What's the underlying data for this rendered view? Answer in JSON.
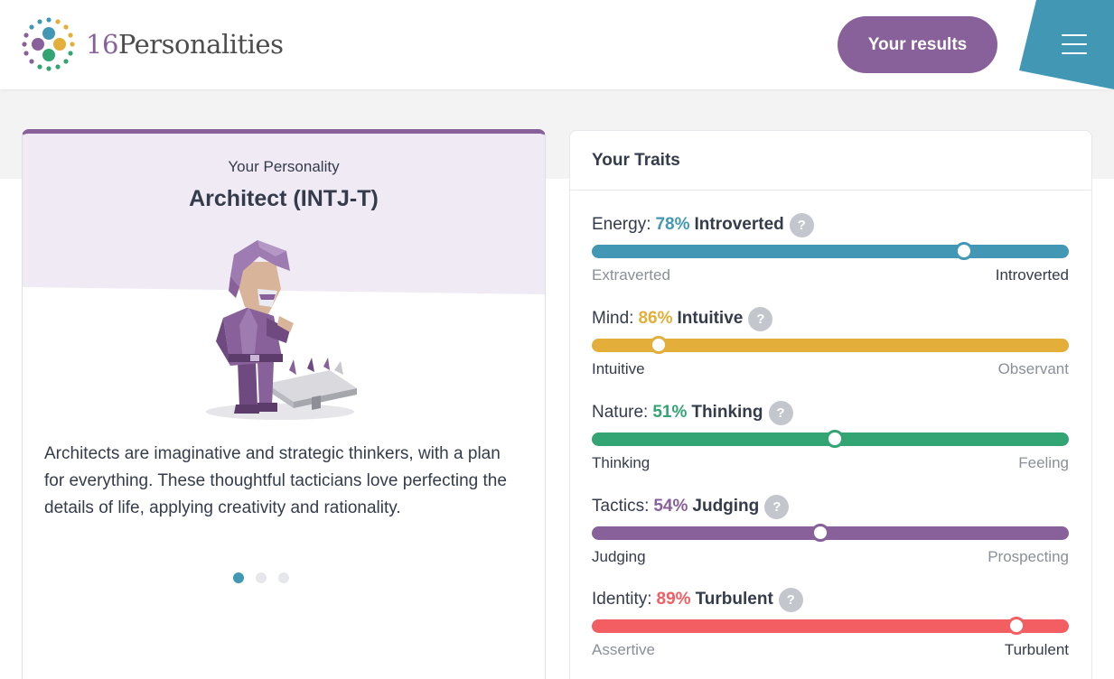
{
  "header": {
    "logo_number": "16",
    "logo_word": "Personalities",
    "results_button": "Your results",
    "accent": "#88619a",
    "menu_color": "#4298b4"
  },
  "personality": {
    "label": "Your Personality",
    "type": "Architect (INTJ-T)",
    "description": "Architects are imaginative and strategic thinkers, with a plan for everything. These thoughtful tacticians love perfecting the details of life, applying creativity and rationality.",
    "carousel_pages": 3,
    "carousel_active": 1
  },
  "traits": {
    "heading": "Your Traits",
    "items": [
      {
        "category": "Energy:",
        "percent": "78%",
        "name": "Introverted",
        "left": "Extraverted",
        "right": "Introverted",
        "position": 0.78,
        "highlight": "right",
        "color": "#4298b4"
      },
      {
        "category": "Mind:",
        "percent": "86%",
        "name": "Intuitive",
        "left": "Intuitive",
        "right": "Observant",
        "position": 0.14,
        "highlight": "left",
        "color": "#e4ae3a"
      },
      {
        "category": "Nature:",
        "percent": "51%",
        "name": "Thinking",
        "left": "Thinking",
        "right": "Feeling",
        "position": 0.51,
        "highlight": "left",
        "color": "#33a474"
      },
      {
        "category": "Tactics:",
        "percent": "54%",
        "name": "Judging",
        "left": "Judging",
        "right": "Prospecting",
        "position": 0.48,
        "highlight": "left",
        "color": "#88619a"
      },
      {
        "category": "Identity:",
        "percent": "89%",
        "name": "Turbulent",
        "left": "Assertive",
        "right": "Turbulent",
        "position": 0.89,
        "highlight": "right",
        "color": "#f25e62"
      }
    ]
  }
}
